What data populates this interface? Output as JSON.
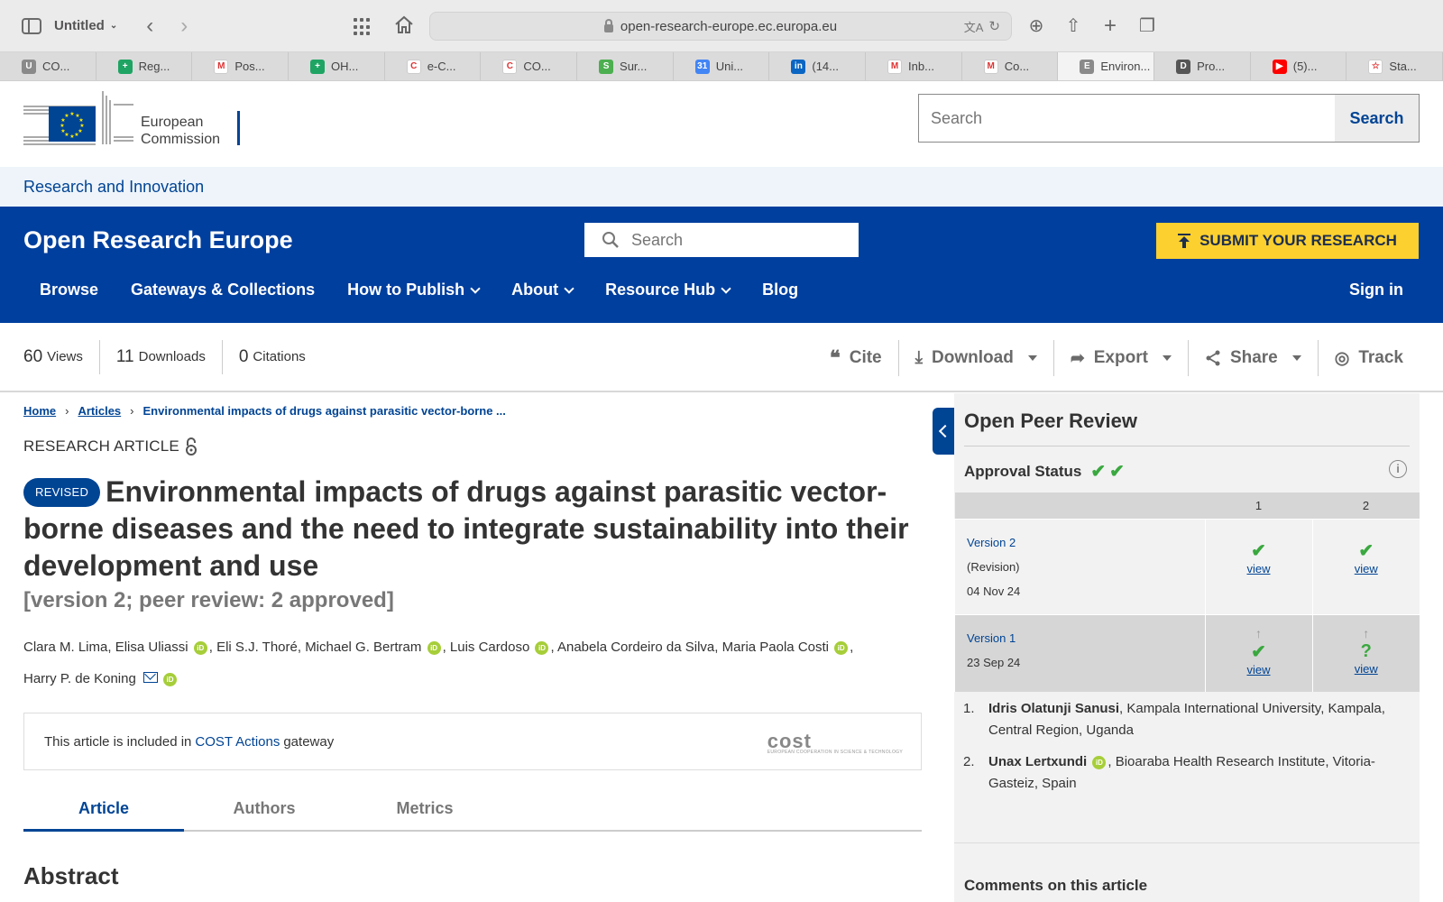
{
  "browser": {
    "window_title": "Untitled",
    "url": "open-research-europe.ec.europa.eu",
    "tabs": [
      {
        "label": "CO...",
        "fav_color": "#8a8a8a",
        "fav_char": "U"
      },
      {
        "label": "Reg...",
        "fav_color": "#1fa463",
        "fav_char": "+"
      },
      {
        "label": "Pos...",
        "fav_color": "#ffffff",
        "fav_char": "M"
      },
      {
        "label": "OH...",
        "fav_color": "#1fa463",
        "fav_char": "+"
      },
      {
        "label": "e-C...",
        "fav_color": "#ffffff",
        "fav_char": "C"
      },
      {
        "label": "CO...",
        "fav_color": "#ffffff",
        "fav_char": "C"
      },
      {
        "label": "Sur...",
        "fav_color": "#4caf50",
        "fav_char": "S"
      },
      {
        "label": "Uni...",
        "fav_color": "#4285f4",
        "fav_char": "31"
      },
      {
        "label": "(14...",
        "fav_color": "#0a66c2",
        "fav_char": "in"
      },
      {
        "label": "Inb...",
        "fav_color": "#ffffff",
        "fav_char": "M"
      },
      {
        "label": "Co...",
        "fav_color": "#ffffff",
        "fav_char": "M"
      },
      {
        "label": "Environ...",
        "fav_color": "#8a8a8a",
        "fav_char": "E",
        "active": true
      },
      {
        "label": "Pro...",
        "fav_color": "#555555",
        "fav_char": "D"
      },
      {
        "label": "(5)...",
        "fav_color": "#ff0000",
        "fav_char": "▶"
      },
      {
        "label": "Sta...",
        "fav_color": "#ffffff",
        "fav_char": "☆"
      }
    ]
  },
  "ec_header": {
    "logo_line1": "European",
    "logo_line2": "Commission",
    "search_placeholder": "Search",
    "search_button": "Search",
    "ri_link": "Research and Innovation"
  },
  "ore": {
    "brand": "Open Research Europe",
    "search_placeholder": "Search",
    "submit_label": "SUBMIT YOUR RESEARCH",
    "menu": [
      "Browse",
      "Gateways & Collections",
      "How to Publish",
      "About",
      "Resource Hub",
      "Blog"
    ],
    "signin": "Sign in"
  },
  "metrics": {
    "views_num": "60",
    "views_label": "Views",
    "downloads_num": "11",
    "downloads_label": "Downloads",
    "citations_num": "0",
    "citations_label": "Citations"
  },
  "actions": {
    "cite": "Cite",
    "download": "Download",
    "export": "Export",
    "share": "Share",
    "track": "Track"
  },
  "breadcrumb": {
    "home": "Home",
    "articles": "Articles",
    "current": "Environmental impacts of drugs against parasitic vector-borne ..."
  },
  "article": {
    "type": "RESEARCH ARTICLE",
    "badge": "REVISED",
    "title": "Environmental impacts of drugs against parasitic vector-borne diseases and the need to integrate sustainability into their development and use",
    "version_note": "[version 2; peer review: 2 approved]",
    "authors_line1": [
      {
        "name": "Clara M. Lima",
        "orcid": false
      },
      {
        "name": "Elisa Uliassi",
        "orcid": true
      },
      {
        "name": "Eli S.J. Thoré",
        "orcid": false
      },
      {
        "name": "Michael G. Bertram",
        "orcid": true
      },
      {
        "name": "Luis Cardoso",
        "orcid": true
      },
      {
        "name": "Anabela Cordeiro da Silva",
        "orcid": false
      },
      {
        "name": "Maria Paola Costi",
        "orcid": true
      }
    ],
    "author_last": "Harry P. de Koning",
    "gateway_prefix": "This article is included in",
    "gateway_link": "COST Actions",
    "gateway_suffix": "gateway",
    "gateway_logo": "cost",
    "gateway_logo_sub": "EUROPEAN COOPERATION IN SCIENCE & TECHNOLOGY",
    "tabs": [
      "Article",
      "Authors",
      "Metrics"
    ],
    "abstract_heading": "Abstract"
  },
  "peer_review": {
    "title": "Open Peer Review",
    "approval_label": "Approval Status",
    "col1": "1",
    "col2": "2",
    "v2_link": "Version 2",
    "v2_note": "(Revision)",
    "v2_date": "04 Nov 24",
    "v1_link": "Version 1",
    "v1_date": "23 Sep 24",
    "view": "view",
    "reviewers": [
      {
        "num": "1.",
        "name": "Idris Olatunji Sanusi",
        "affil": ", Kampala International University, Kampala, Central Region, Uganda",
        "orcid": false
      },
      {
        "num": "2.",
        "name": "Unax Lertxundi",
        "affil": ", Bioaraba Health Research Institute, Vitoria-Gasteiz, Spain",
        "orcid": true
      }
    ],
    "comments_heading": "Comments on this article"
  },
  "colors": {
    "ec_blue": "#004494",
    "ore_blue": "#003f9e",
    "submit_yellow": "#fcd02f",
    "approved_green": "#3aa83f",
    "orcid_green": "#a6ce39"
  }
}
